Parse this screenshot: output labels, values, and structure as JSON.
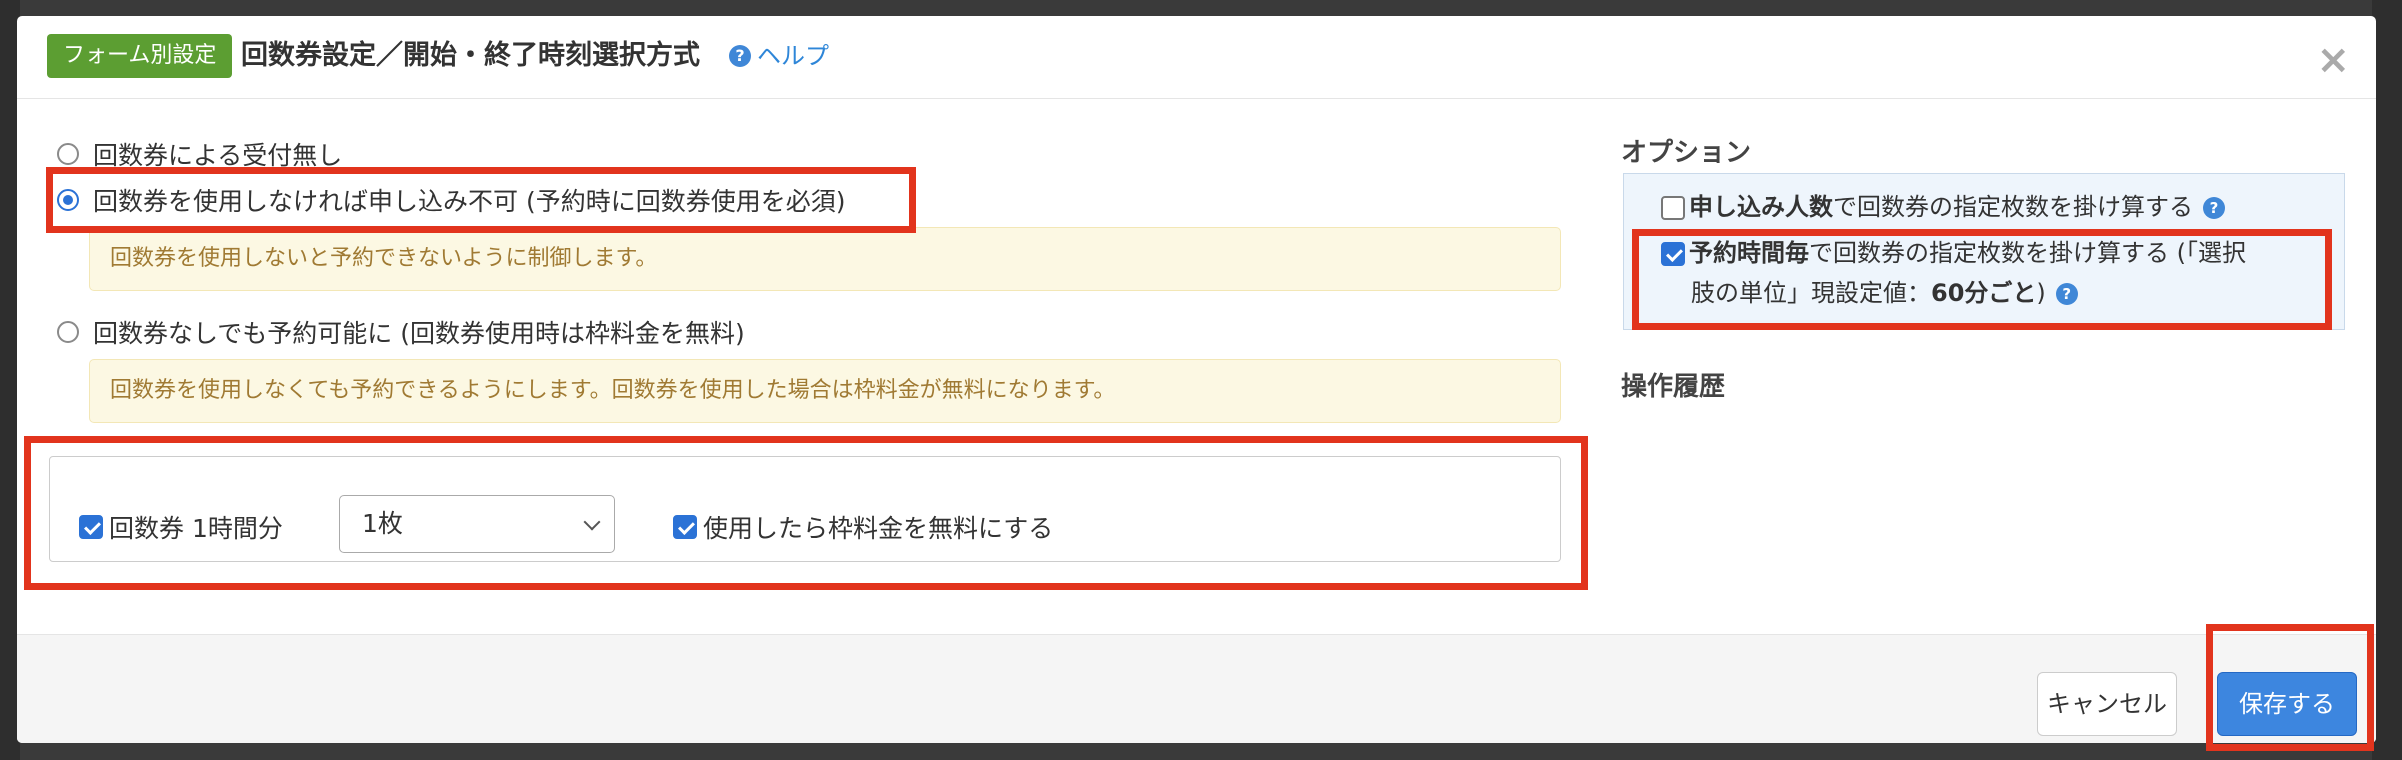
{
  "header": {
    "badge": "フォーム別設定",
    "title": "回数券設定／開始・終了時刻選択方式",
    "help_icon": "?",
    "help_link": "ヘルプ",
    "close": "×"
  },
  "radio_options": [
    {
      "label": "回数券による受付無し",
      "checked": false
    },
    {
      "label": "回数券を使用しなければ申し込み不可 (予約時に回数券使用を必須)",
      "checked": true,
      "note": "回数券を使用しないと予約できないように制御します。"
    },
    {
      "label": "回数券なしでも予約可能に (回数券使用時は枠料金を無料)",
      "checked": false,
      "note": "回数券を使用しなくても予約できるようにします。回数券を使用した場合は枠料金が無料になります。"
    }
  ],
  "ticket_box": {
    "ticket_label": "回数券 1時間分",
    "ticket_checked": true,
    "select_value": "1枚",
    "free_label": "使用したら枠料金を無料にする",
    "free_checked": true
  },
  "options": {
    "title": "オプション",
    "opt1_bold": "申し込み人数",
    "opt1_rest": "で回数券の指定枚数を掛け算する",
    "opt1_checked": false,
    "opt2_bold": "予約時間毎",
    "opt2_rest1": "で回数券の指定枚数を掛け算する (「選択",
    "opt2_rest2": "肢の単位」現設定値：",
    "opt2_value": "60分ごと",
    "opt2_close": ")",
    "opt2_checked": true,
    "q": "?"
  },
  "history": {
    "title": "操作履歴"
  },
  "footer": {
    "cancel_label": "キャンセル",
    "save_label": "保存する"
  },
  "colors": {
    "highlight": "#e2341d",
    "badge_green": "#5c9e32",
    "primary_blue": "#3d86df",
    "note_bg": "#fcf8e3"
  }
}
